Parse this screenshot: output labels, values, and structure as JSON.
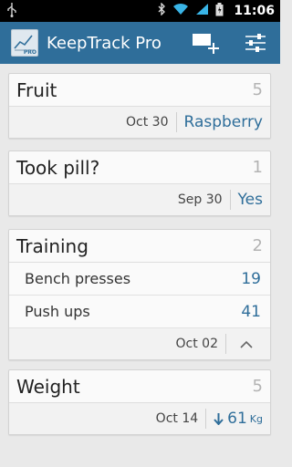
{
  "status_bar": {
    "time": "11:06"
  },
  "app": {
    "title": "KeepTrack Pro",
    "logo_badge": "PRO"
  },
  "cards": {
    "fruit": {
      "title": "Fruit",
      "count": "5",
      "date": "Oct 30",
      "value": "Raspberry"
    },
    "pill": {
      "title": "Took pill?",
      "count": "1",
      "date": "Sep 30",
      "value": "Yes"
    },
    "training": {
      "title": "Training",
      "count": "2",
      "date": "Oct 02",
      "rows": [
        {
          "label": "Bench presses",
          "value": "19"
        },
        {
          "label": "Push ups",
          "value": "41"
        }
      ]
    },
    "weight": {
      "title": "Weight",
      "count": "5",
      "date": "Oct 14",
      "value": "61",
      "unit": "Kg"
    }
  },
  "colors": {
    "accent": "#2f6e9a",
    "background": "#e9e9e9"
  },
  "icons": [
    "usb-icon",
    "bluetooth-icon",
    "wifi-icon",
    "signal-icon",
    "battery-icon",
    "add-tracker-icon",
    "settings-sliders-icon",
    "chevron-up-icon",
    "arrow-down-icon"
  ]
}
